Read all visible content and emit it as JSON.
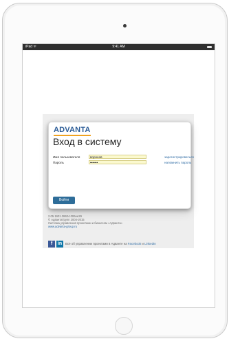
{
  "status_bar": {
    "carrier": "iPad ᯤ",
    "time": "9:41 AM"
  },
  "login": {
    "logo": "ADVANTA",
    "title": "Вход в систему",
    "username_label": "Имя пользователя",
    "username_value": "воронов",
    "password_label": "Пароль",
    "password_value": "•••••••",
    "register_link": "зарегистрироваться",
    "remind_link": "напомнить пароль",
    "submit_label": "Войти"
  },
  "footer": {
    "version": "2.05.1601.38624.006ee29",
    "copyright": "© АдвантаГрупп 2004-2015",
    "product": "Система управления проектами и бизнесом «Адванта»",
    "site": "www.advanta-group.ru"
  },
  "social": {
    "fb_label": "f",
    "in_label": "in",
    "text_prefix": "Всё об управлении проектами в Адванте на ",
    "facebook": "Facebook",
    "and": " и ",
    "linkedin": "LinkedIn"
  },
  "colors": {
    "brand_blue": "#2a5b96",
    "button_blue": "#2e6d99",
    "link_blue": "#2d6aa3",
    "input_yellow": "#fbf9cf"
  }
}
